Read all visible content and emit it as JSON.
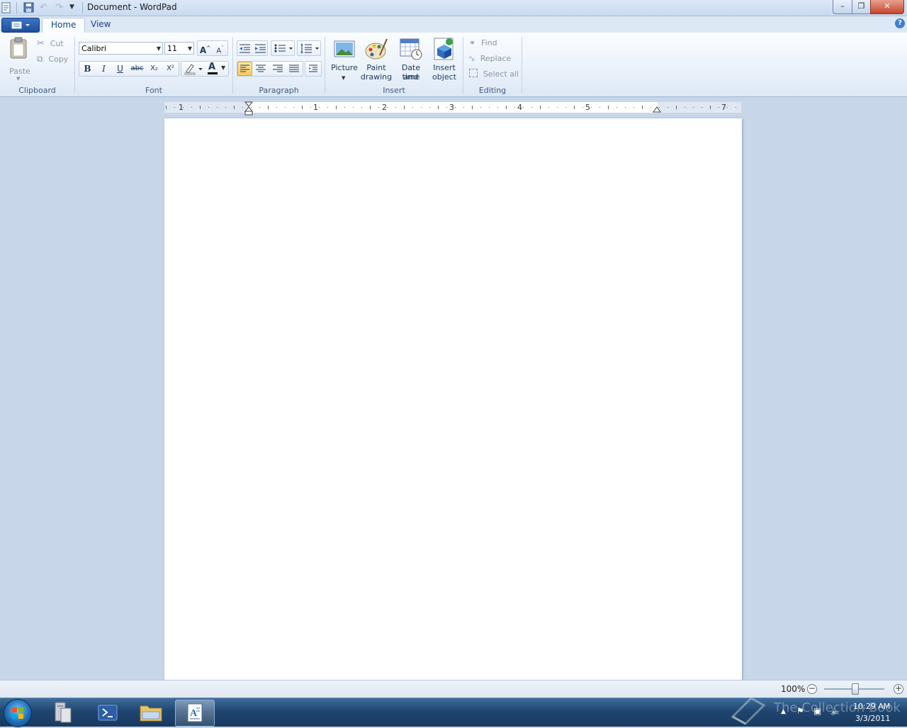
{
  "window": {
    "title": "Document - WordPad",
    "minimize": "–",
    "maximize": "❐",
    "close": "✕"
  },
  "tabs": [
    {
      "label": "Home"
    },
    {
      "label": "View"
    }
  ],
  "help": "?",
  "clipboard": {
    "group": "Clipboard",
    "paste": "Paste",
    "cut": "Cut",
    "copy": "Copy"
  },
  "font": {
    "group": "Font",
    "family": "Calibri",
    "size": "11",
    "grow": "A",
    "shrink": "A",
    "bold": "B",
    "italic": "I",
    "underline": "U",
    "strike": "abc",
    "subscript": "X₂",
    "superscript": "X²",
    "color_glyph": "A",
    "text_color": "#000000",
    "highlight_color": "#ffffff"
  },
  "paragraph": {
    "group": "Paragraph"
  },
  "insert": {
    "group": "Insert",
    "picture": "Picture",
    "paint1": "Paint",
    "paint2": "drawing",
    "date1": "Date and",
    "date2": "time",
    "obj1": "Insert",
    "obj2": "object"
  },
  "editing": {
    "group": "Editing",
    "find": "Find",
    "replace": "Replace",
    "select_all": "Select all"
  },
  "ruler": {
    "labels": [
      "1",
      "1",
      "2",
      "3",
      "4",
      "5",
      "7"
    ]
  },
  "status": {
    "zoom": "100%",
    "zoom_out": "−",
    "zoom_in": "+",
    "zoom_fraction": 0.5
  },
  "taskbar": {
    "time": "10:29 AM",
    "date": "3/3/2011",
    "watermark": "The Collection Book"
  },
  "colors": {
    "accent": "#1d4f9c",
    "selected": "#f7c85b"
  }
}
